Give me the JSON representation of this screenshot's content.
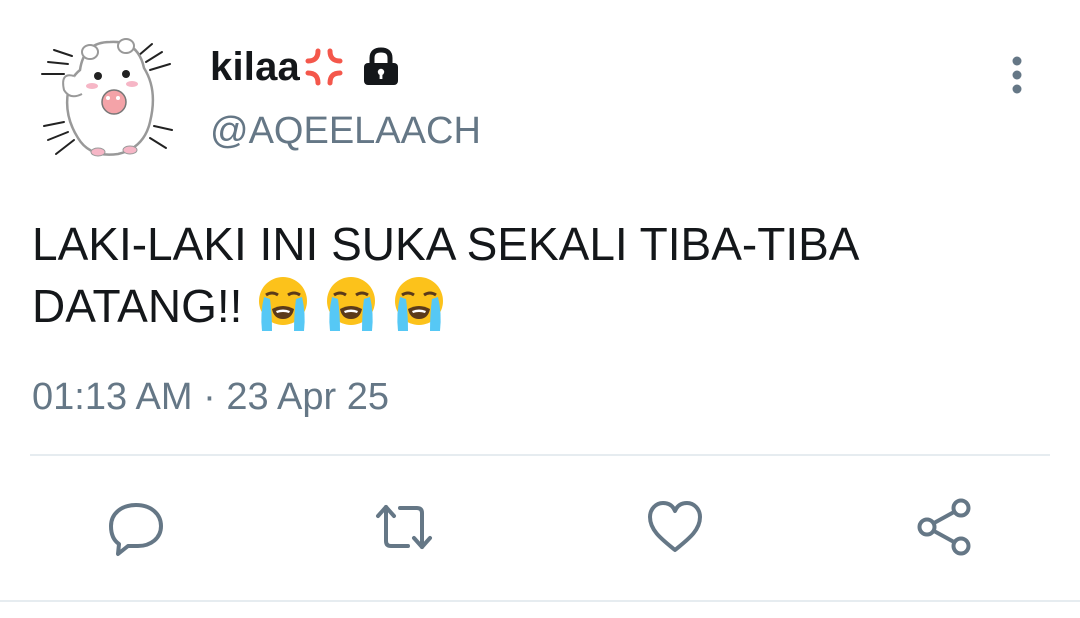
{
  "tweet": {
    "display_name": "kilaa",
    "handle": "@AQEELAACH",
    "text": "LAKI-LAKI INI SUKA SEKALI TIBA-TIBA DATANG!!",
    "timestamp": "01:13 AM · 23 Apr 25",
    "name_emoji": "anger-symbol-icon",
    "protected_icon": "lock-icon",
    "text_emojis": [
      "loudly-crying-face-icon",
      "loudly-crying-face-icon",
      "loudly-crying-face-icon"
    ]
  },
  "actions": [
    "reply",
    "retweet",
    "like",
    "share"
  ],
  "colors": {
    "text_primary": "#14171a",
    "text_secondary": "#657786",
    "icon": "#657786",
    "divider": "#e6ecf0",
    "anger": "#f4574b"
  }
}
